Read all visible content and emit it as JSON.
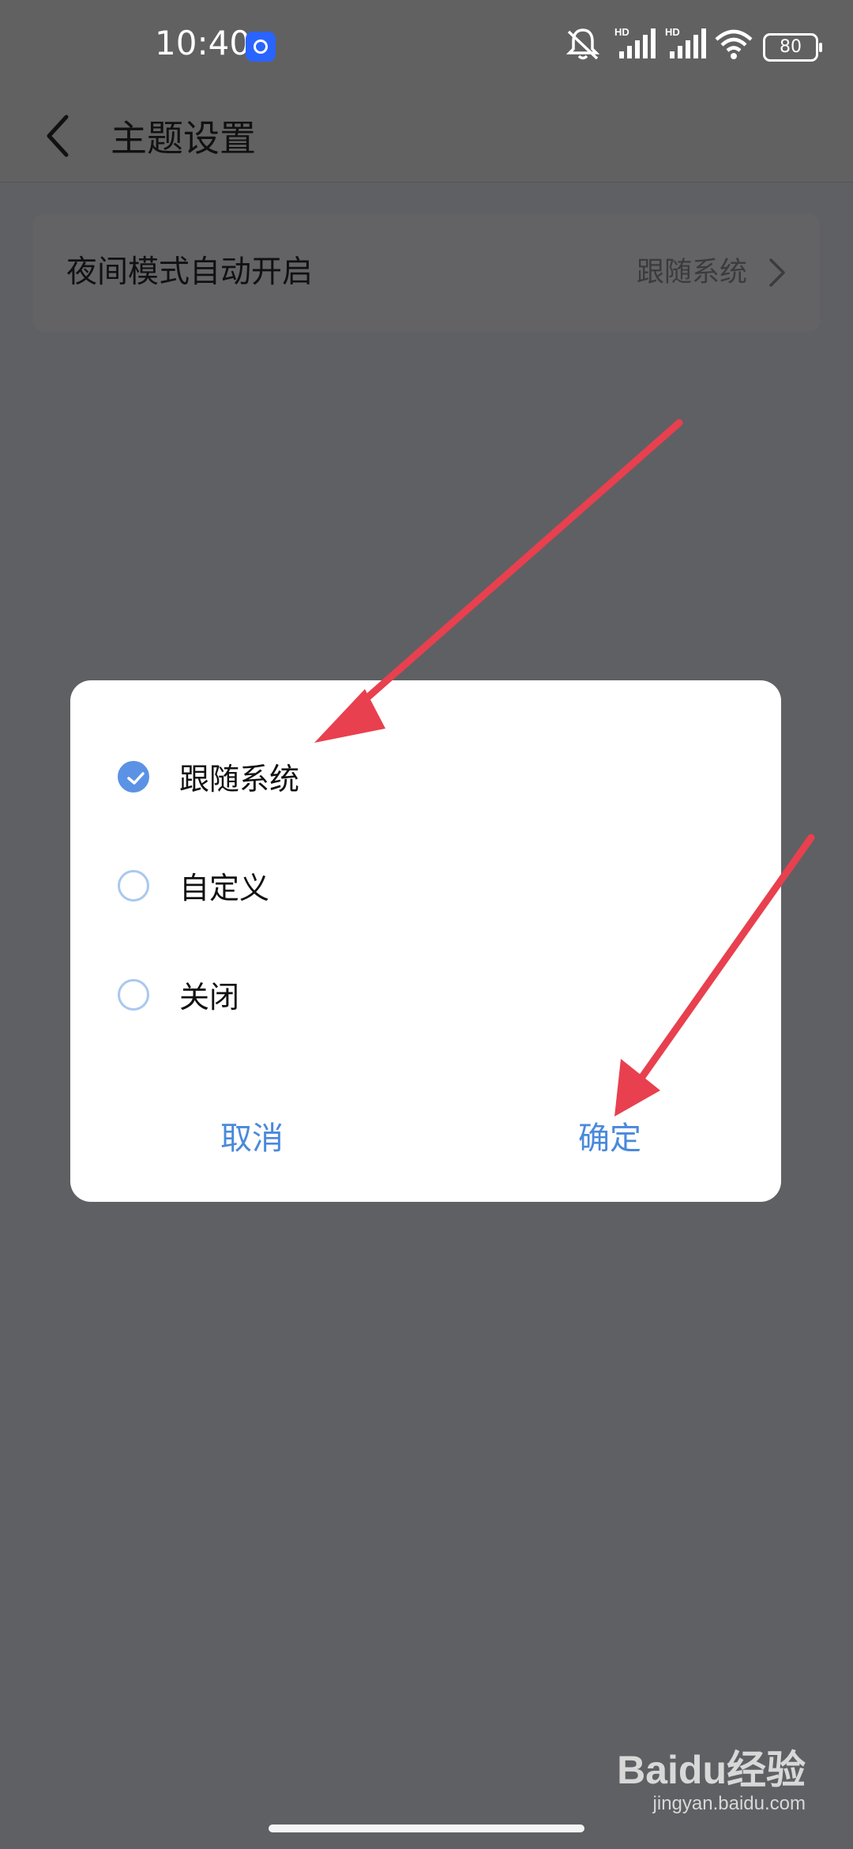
{
  "status_bar": {
    "time": "10:40",
    "battery": "80",
    "icons": [
      "app-notification-icon",
      "mute-icon",
      "hd-signal-icon",
      "hd-signal-icon",
      "wifi-icon",
      "battery-icon"
    ]
  },
  "header": {
    "title": "主题设置",
    "back_icon": "chevron-left-icon"
  },
  "setting": {
    "label": "夜间模式自动开启",
    "value": "跟随系统"
  },
  "dialog": {
    "options": [
      {
        "label": "跟随系统",
        "checked": true
      },
      {
        "label": "自定义",
        "checked": false
      },
      {
        "label": "关闭",
        "checked": false
      }
    ],
    "cancel_label": "取消",
    "confirm_label": "确定"
  },
  "colors": {
    "accent": "#4a89dc",
    "annotation_arrow": "#e8404f",
    "scrim": "#5f6064"
  },
  "watermark": {
    "logo": "Baidu经验",
    "url": "jingyan.baidu.com"
  }
}
